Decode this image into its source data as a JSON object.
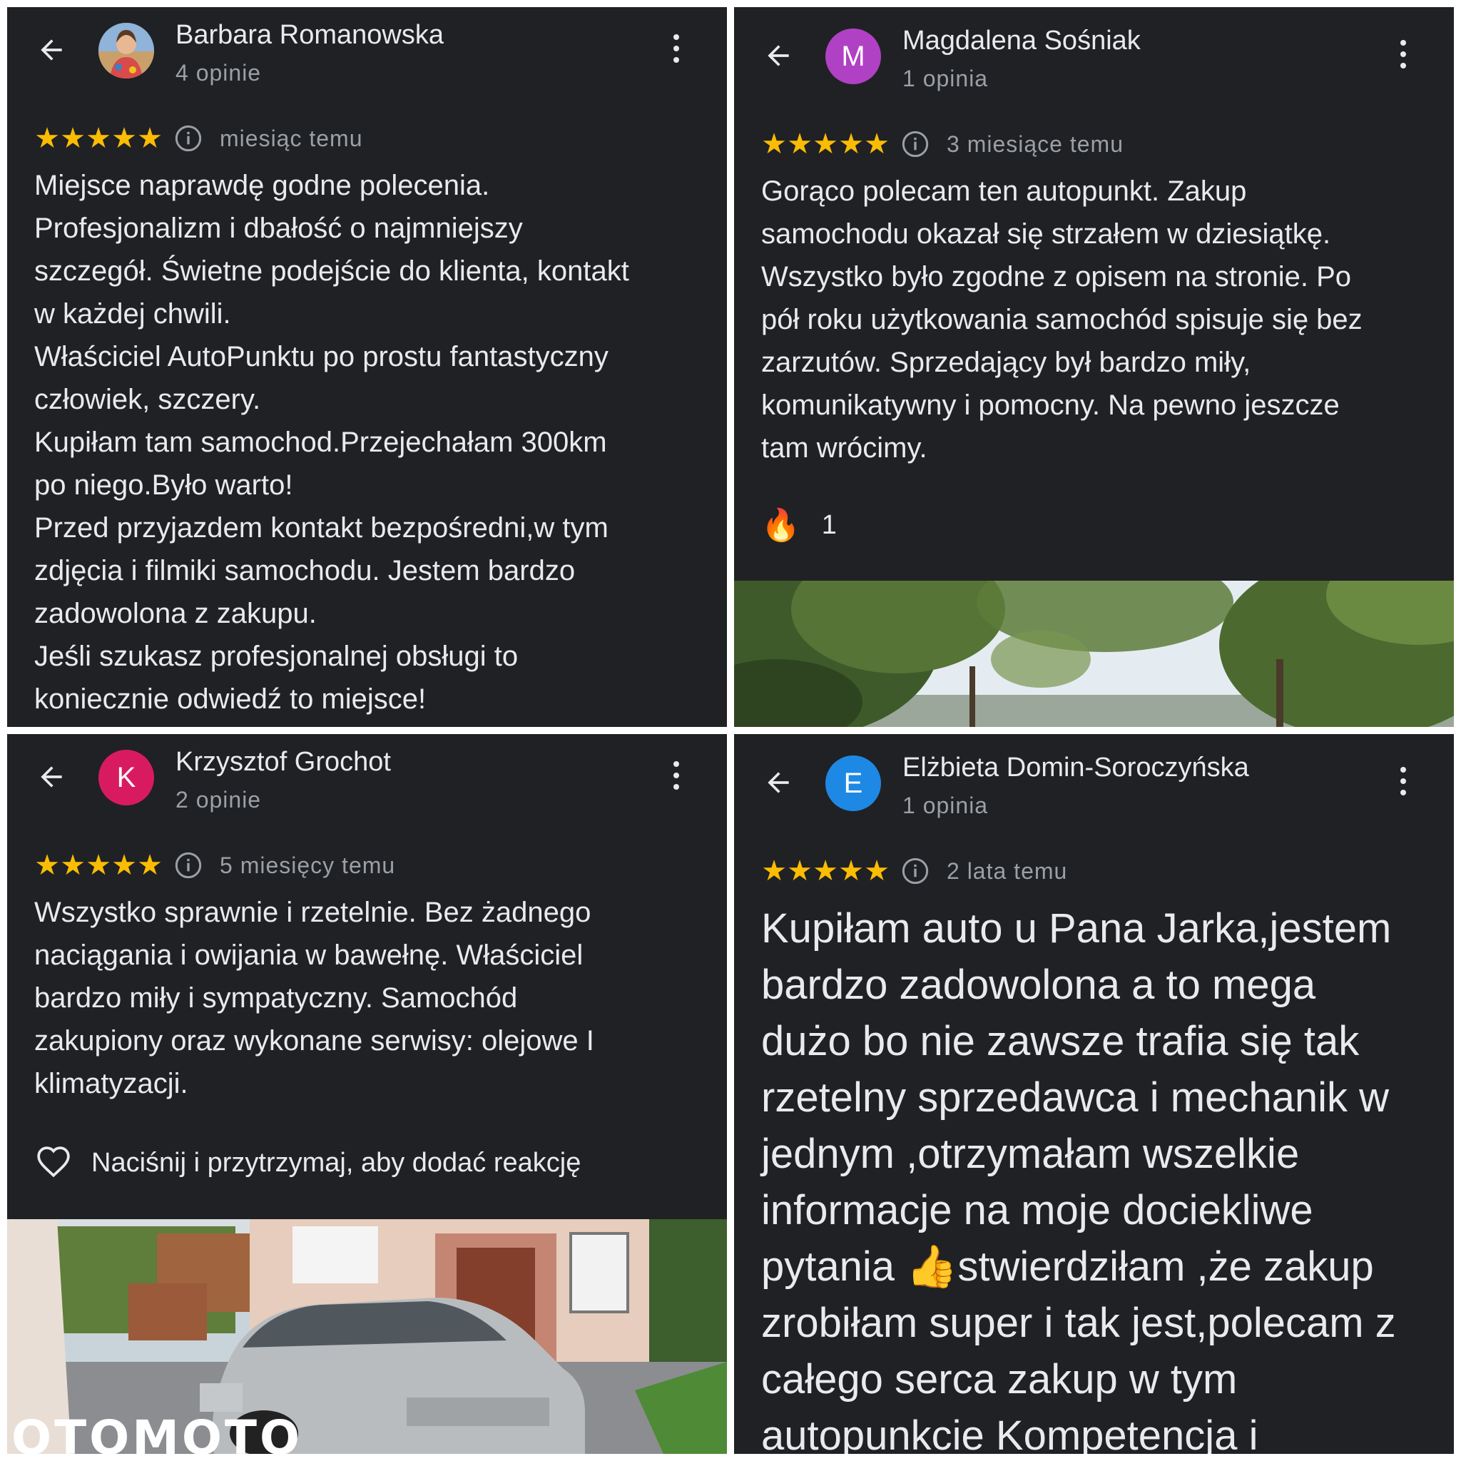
{
  "reviews": [
    {
      "name": "Barbara Romanowska",
      "count": "4 opinie",
      "date": "miesiąc temu",
      "stars": 5,
      "lines": [
        "Miejsce naprawdę godne polecenia.",
        "Profesjonalizm i dbałość o najmniejszy",
        "szczegół. Świetne podejście do klienta, kontakt",
        "w każdej chwili.",
        "Właściciel AutoPunktu po prostu fantastyczny",
        "człowiek, szczery.",
        "Kupiłam tam samochod.Przejechałam 300km",
        "po niego.Było warto!",
        "Przed przyjazdem kontakt bezpośredni,w tym",
        "zdjęcia i filmiki samochodu. Jestem bardzo",
        "zadowolona z zakupu.",
        "Jeśli szukasz profesjonalnej obsługi to",
        "koniecznie odwiedź to miejsce!"
      ]
    },
    {
      "name": "Magdalena Sośniak",
      "count": "1 opinia",
      "date": "3 miesiące temu",
      "avatar_letter": "M",
      "avatar_color": "#b041c4",
      "stars": 5,
      "lines": [
        "Gorąco polecam ten autopunkt. Zakup",
        "samochodu okazał się strzałem w dziesiątkę.",
        "Wszystko było zgodne z opisem na stronie. Po",
        "pół roku użytkowania samochód spisuje się bez",
        "zarzutów. Sprzedający był bardzo miły,",
        "komunikatywny i pomocny. Na pewno jeszcze",
        "tam wrócimy."
      ],
      "reaction_emoji": "🔥",
      "reaction_count": "1"
    },
    {
      "name": "Krzysztof Grochot",
      "count": "2 opinie",
      "date": "5 miesięcy temu",
      "avatar_letter": "K",
      "avatar_color": "#d81b60",
      "stars": 5,
      "lines": [
        "Wszystko sprawnie i rzetelnie. Bez żadnego",
        "naciągania i owijania w bawełnę. Właściciel",
        "bardzo miły i sympatyczny. Samochód",
        "zakupiony oraz wykonane serwisy: olejowe I",
        "klimatyzacji."
      ],
      "reaction_prompt": "Naciśnij i przytrzymaj, aby dodać reakcję",
      "watermark": "OTOMOTO"
    },
    {
      "name": "Elżbieta Domin-Soroczyńska",
      "count": "1 opinia",
      "date": "2 lata temu",
      "avatar_letter": "E",
      "avatar_color": "#1e88e5",
      "stars": 5,
      "lines": [
        "Kupiłam auto u Pana Jarka,jestem",
        "bardzo zadowolona a to mega",
        "dużo bo nie zawsze trafia się tak",
        "rzetelny sprzedawca i mechanik w",
        "jednym ,otrzymałam wszelkie",
        "informacje na moje dociekliwe",
        "pytania 👍stwierdziłam ,że zakup",
        "zrobiłam super i tak jest,polecam z",
        "całego serca  zakup w tym",
        "autopunkcie Kompetencja i"
      ]
    }
  ],
  "colors": {
    "background": "#202124",
    "star": "#fbbc04",
    "text": "#e8eaed",
    "muted": "#9aa0a6"
  }
}
